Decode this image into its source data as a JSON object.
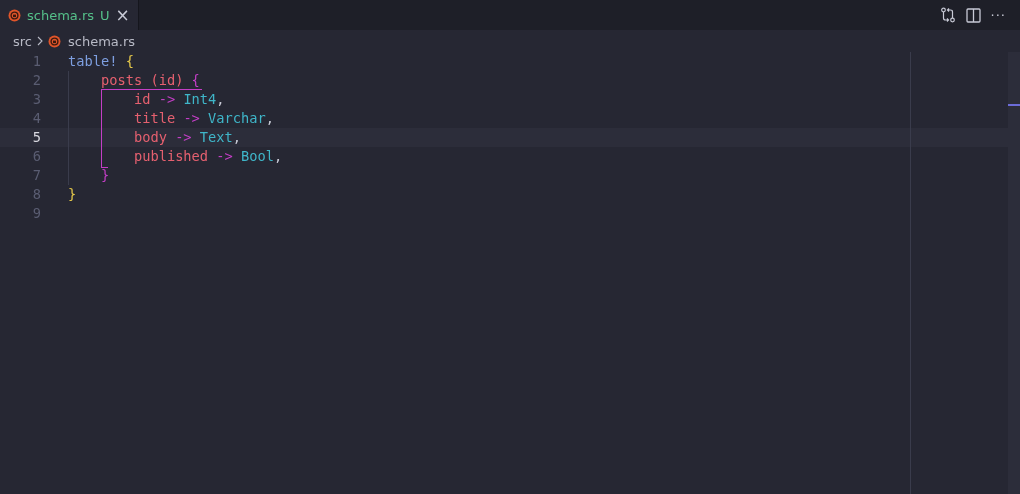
{
  "tabs": [
    {
      "label": "schema.rs",
      "badge": "U",
      "selected": true,
      "close": "×"
    }
  ],
  "toolbar": {
    "more": "···"
  },
  "breadcrumbs": [
    {
      "label": "src",
      "kind": "folder"
    },
    {
      "label": "schema.rs",
      "kind": "file"
    }
  ],
  "editor": {
    "lines": [
      {
        "number": "1",
        "active": false,
        "tokens": [
          {
            "text": "table!",
            "kind": "macro"
          },
          {
            "text": " {",
            "kind": "brace1"
          }
        ]
      },
      {
        "number": "2",
        "active": false,
        "tokens": [
          {
            "text": "    posts",
            "kind": "field"
          },
          {
            "text": " (id)",
            "kind": "field"
          },
          {
            "text": " {",
            "kind": "brace2"
          }
        ]
      },
      {
        "number": "3",
        "active": false,
        "tokens": [
          {
            "text": "        id",
            "kind": "field"
          },
          {
            "text": " ->",
            "kind": "arrow"
          },
          {
            "text": " Int4",
            "kind": "type"
          },
          {
            "text": ",",
            "kind": "punct"
          }
        ]
      },
      {
        "number": "4",
        "active": false,
        "tokens": [
          {
            "text": "        title",
            "kind": "field"
          },
          {
            "text": " ->",
            "kind": "arrow"
          },
          {
            "text": " Varchar",
            "kind": "type"
          },
          {
            "text": ",",
            "kind": "punct"
          }
        ]
      },
      {
        "number": "5",
        "active": true,
        "tokens": [
          {
            "text": "        body",
            "kind": "field"
          },
          {
            "text": " ->",
            "kind": "arrow"
          },
          {
            "text": " Text",
            "kind": "type"
          },
          {
            "text": ",",
            "kind": "punct"
          }
        ]
      },
      {
        "number": "6",
        "active": false,
        "tokens": [
          {
            "text": "        published",
            "kind": "field"
          },
          {
            "text": " ->",
            "kind": "arrow"
          },
          {
            "text": " Bool",
            "kind": "type"
          },
          {
            "text": ",",
            "kind": "punct"
          }
        ]
      },
      {
        "number": "7",
        "active": false,
        "tokens": [
          {
            "text": "    }",
            "kind": "brace2"
          }
        ]
      },
      {
        "number": "8",
        "active": false,
        "tokens": [
          {
            "text": "}",
            "kind": "brace1"
          }
        ]
      },
      {
        "number": "9",
        "active": false
      }
    ]
  }
}
